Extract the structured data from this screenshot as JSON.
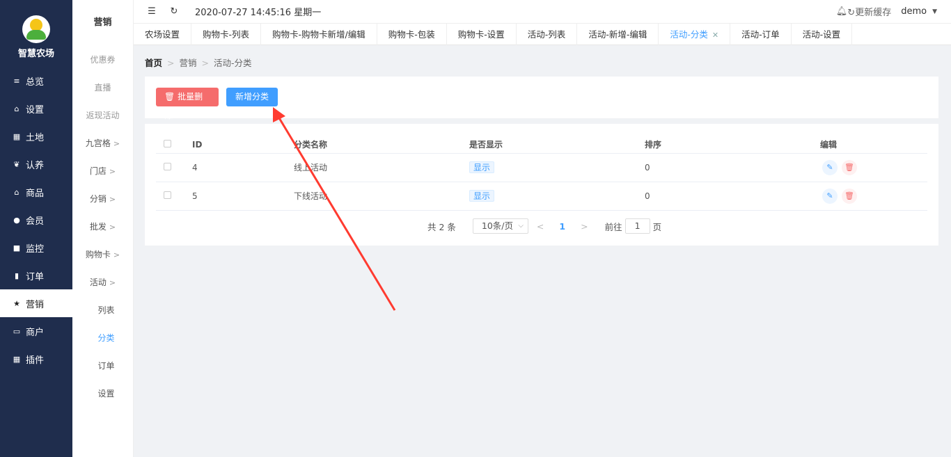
{
  "brand": {
    "name": "智慧农场"
  },
  "nav": [
    {
      "icon": "≡",
      "label": "总览"
    },
    {
      "icon": "⌂",
      "label": "设置"
    },
    {
      "icon": "▦",
      "label": "土地"
    },
    {
      "icon": "❦",
      "label": "认养"
    },
    {
      "icon": "⌂",
      "label": "商品"
    },
    {
      "icon": "●",
      "label": "会员"
    },
    {
      "icon": "■",
      "label": "监控"
    },
    {
      "icon": "▮",
      "label": "订单"
    },
    {
      "icon": "★",
      "label": "营销"
    },
    {
      "icon": "▭",
      "label": "商户"
    },
    {
      "icon": "▦",
      "label": "插件"
    }
  ],
  "submenu": {
    "title": "营销",
    "items": [
      "优惠券",
      "直播",
      "返现活动",
      "九宫格",
      "门店",
      "分销",
      "批发",
      "购物卡",
      "活动",
      "列表",
      "分类",
      "订单",
      "设置"
    ]
  },
  "topbar": {
    "datetime": "2020-07-27 14:45:16 星期一",
    "refresh_cache": "更新缓存",
    "user": "demo"
  },
  "tabs": [
    "农场设置",
    "购物卡-列表",
    "购物卡-购物卡新增/编辑",
    "购物卡-包装",
    "购物卡-设置",
    "活动-列表",
    "活动-新增-编辑",
    "活动-分类",
    "活动-订单",
    "活动-设置"
  ],
  "breadcrumb": [
    "首页",
    "营销",
    "活动-分类"
  ],
  "toolbar": {
    "batch_delete": "批量删除",
    "add_category": "新增分类"
  },
  "table": {
    "headers": [
      "ID",
      "分类名称",
      "是否显示",
      "排序",
      "编辑"
    ],
    "rows": [
      {
        "id": "4",
        "name": "线上活动",
        "show": "显示",
        "sort": "0"
      },
      {
        "id": "5",
        "name": "下线活动",
        "show": "显示",
        "sort": "0"
      }
    ]
  },
  "pagination": {
    "total": "共 2 条",
    "page_size": "10条/页",
    "current": "1",
    "goto_label": "前往",
    "goto_value": "1",
    "page_unit": "页"
  },
  "colors": {
    "sidebar_bg": "#1f2d4d",
    "primary": "#409eff",
    "danger": "#f56c6c",
    "annotation_arrow": "#ff3b30"
  }
}
